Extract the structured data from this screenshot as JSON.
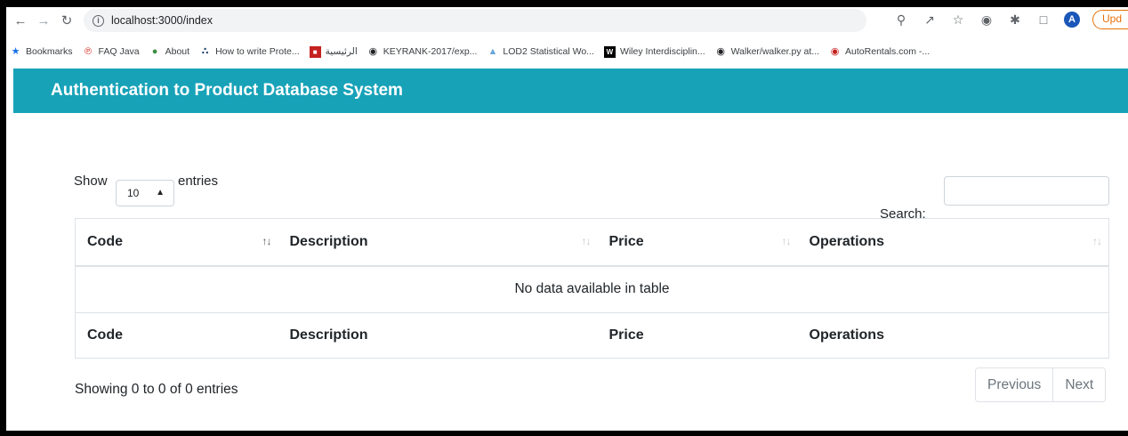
{
  "browser": {
    "url": "localhost:3000/index",
    "update_label": "Upd",
    "profile_initial": "A",
    "bookmarks": [
      {
        "label": "Bookmarks",
        "icon": "star-icon"
      },
      {
        "label": "FAQ Java",
        "icon": "java-icon"
      },
      {
        "label": "About",
        "icon": "brain-icon"
      },
      {
        "label": "How to write Prote...",
        "icon": "link-icon"
      },
      {
        "label": "الرئيسية",
        "icon": "site-icon"
      },
      {
        "label": "KEYRANK-2017/exp...",
        "icon": "github-icon"
      },
      {
        "label": "LOD2 Statistical Wo...",
        "icon": "chart-icon"
      },
      {
        "label": "Wiley Interdisciplin...",
        "icon": "wiley-icon"
      },
      {
        "label": "Walker/walker.py at...",
        "icon": "github-icon"
      },
      {
        "label": "AutoRentals.com -...",
        "icon": "car-icon"
      }
    ]
  },
  "app": {
    "title": "Authentication to Product Database System",
    "header_color": "#17a2b8"
  },
  "table_controls": {
    "show_label": "Show",
    "page_length": "10",
    "entries_label": "entries",
    "search_label": "Search:",
    "search_value": ""
  },
  "table": {
    "columns": [
      "Code",
      "Description",
      "Price",
      "Operations"
    ],
    "empty_message": "No data available in table",
    "footer_columns": [
      "Code",
      "Description",
      "Price",
      "Operations"
    ]
  },
  "footer": {
    "info": "Showing 0 to 0 of 0 entries",
    "previous_label": "Previous",
    "next_label": "Next"
  }
}
